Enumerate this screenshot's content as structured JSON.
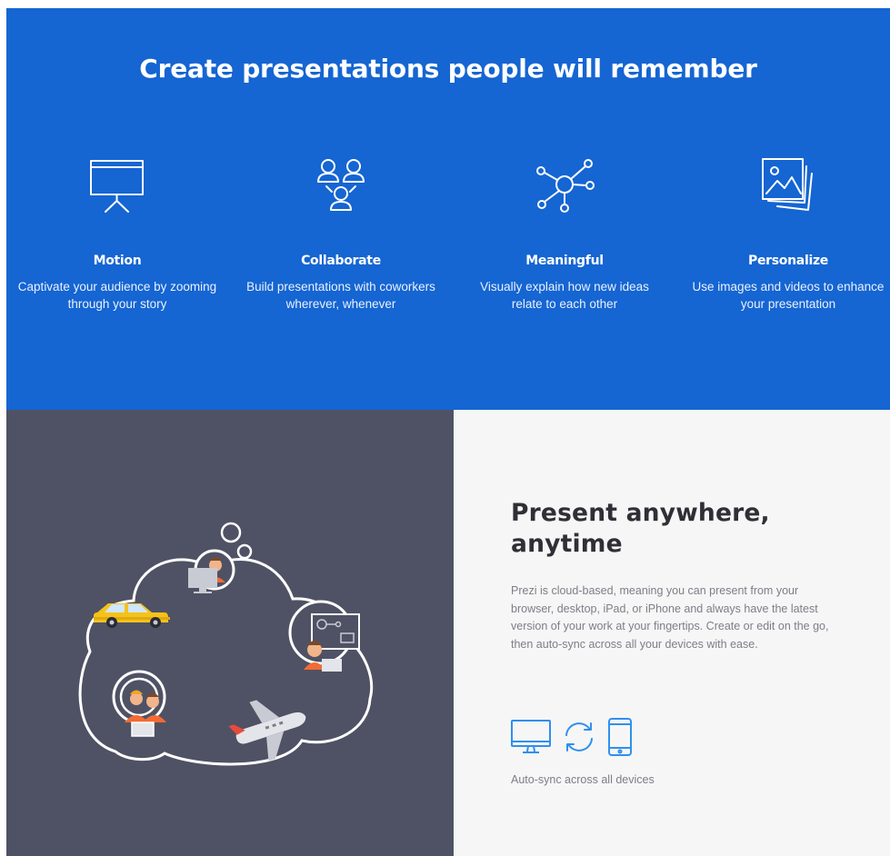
{
  "hero": {
    "title": "Create presentations people will remember",
    "background": "#1565d2",
    "features": [
      {
        "icon": "presentation-screen-icon",
        "title": "Motion",
        "description": "Captivate your audience by zooming through your story"
      },
      {
        "icon": "collaboration-people-icon",
        "title": "Collaborate",
        "description": "Build presentations with coworkers wherever, whenever"
      },
      {
        "icon": "network-nodes-icon",
        "title": "Meaningful",
        "description": "Visually explain how new ideas relate to each other"
      },
      {
        "icon": "image-gallery-icon",
        "title": "Personalize",
        "description": "Use images and videos to enhance your presentation"
      }
    ]
  },
  "illustration": {
    "name": "cloud-travel-illustration",
    "background": "#4f5264"
  },
  "present": {
    "title_line1": "Present anywhere,",
    "title_line2": "anytime",
    "body": "Prezi is cloud-based, meaning you can present from your browser, desktop, iPad, or iPhone and always have the latest version of your work at your fingertips. Create or edit on the go, then auto-sync across all your devices with ease.",
    "icons": [
      "desktop-monitor-icon",
      "sync-arrows-icon",
      "smartphone-icon"
    ],
    "icon_color": "#2f8ff0",
    "caption": "Auto-sync across all devices"
  }
}
